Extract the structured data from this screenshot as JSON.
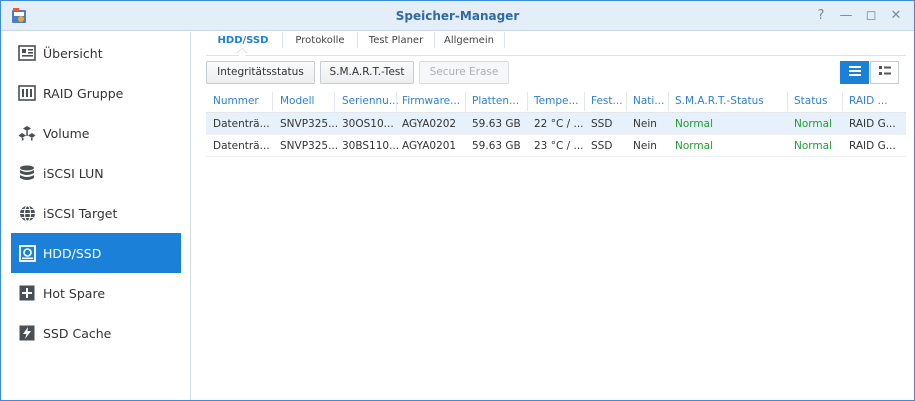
{
  "window": {
    "title": "Speicher-Manager",
    "controls": {
      "help": "?",
      "minimize": "—",
      "maximize": "◻",
      "close": "✕"
    }
  },
  "sidebar": {
    "items": [
      {
        "label": "Übersicht",
        "icon": "overview-icon",
        "active": false
      },
      {
        "label": "RAID Gruppe",
        "icon": "raid-icon",
        "active": false
      },
      {
        "label": "Volume",
        "icon": "volume-icon",
        "active": false
      },
      {
        "label": "iSCSI LUN",
        "icon": "database-icon",
        "active": false
      },
      {
        "label": "iSCSI Target",
        "icon": "globe-icon",
        "active": false
      },
      {
        "label": "HDD/SSD",
        "icon": "disk-icon",
        "active": true
      },
      {
        "label": "Hot Spare",
        "icon": "plus-box-icon",
        "active": false
      },
      {
        "label": "SSD Cache",
        "icon": "lightning-icon",
        "active": false
      }
    ]
  },
  "tabs": [
    "HDD/SSD",
    "Protokolle",
    "Test Planer",
    "Allgemein"
  ],
  "toolbar": {
    "integrity": "Integritätsstatus",
    "smart": "S.M.A.R.T.-Test",
    "secure_erase": "Secure Erase"
  },
  "table": {
    "columns": [
      "Nummer",
      "Modell",
      "Seriennu...",
      "Firmware...",
      "Platten...",
      "Tempe...",
      "Fest...",
      "Nati...",
      "S.M.A.R.T.-Status",
      "Status",
      "RAID ..."
    ],
    "rows": [
      [
        "Datenträ...",
        "SNVP325...",
        "30OS10...",
        "AGYA0202",
        "59.63 GB",
        "22 °C / ...",
        "SSD",
        "Nein",
        "Normal",
        "Normal",
        "RAID G..."
      ],
      [
        "Datenträ...",
        "SNVP325...",
        "30BS110...",
        "AGYA0201",
        "59.63 GB",
        "23 °C / ...",
        "SSD",
        "Nein",
        "Normal",
        "Normal",
        "RAID G..."
      ]
    ]
  },
  "colors": {
    "accent": "#1b80d8",
    "status_ok": "#1f9e2f",
    "header_text": "#2f7fd0"
  }
}
